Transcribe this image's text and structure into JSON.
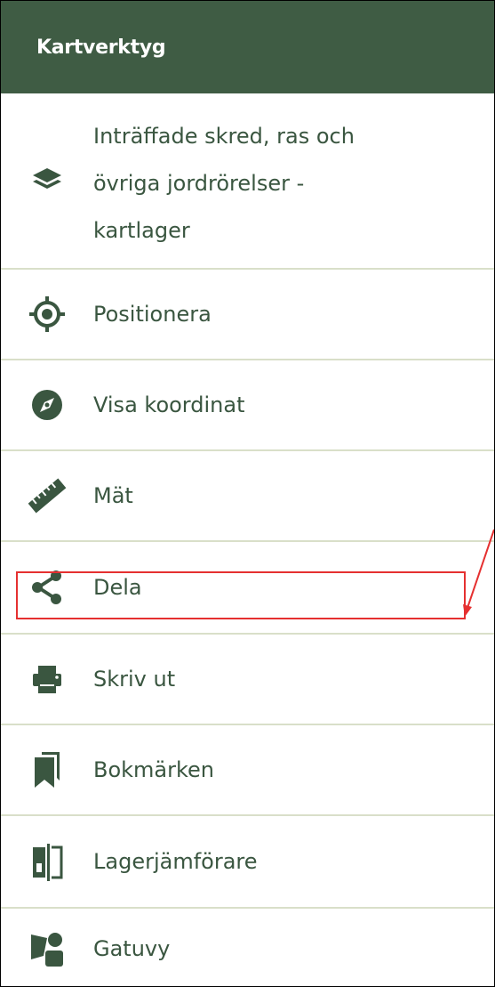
{
  "header": {
    "title": "Kartverktyg"
  },
  "items": [
    {
      "label_lines": [
        "Inträffade skred, ras och",
        "övriga jordrörelser -",
        "kartlager"
      ],
      "icon": "layers-icon"
    },
    {
      "label": "Positionera",
      "icon": "crosshair-icon"
    },
    {
      "label": "Visa koordinat",
      "icon": "compass-icon"
    },
    {
      "label": "Mät",
      "icon": "ruler-icon"
    },
    {
      "label": "Dela",
      "icon": "share-icon"
    },
    {
      "label": "Skriv ut",
      "icon": "print-icon"
    },
    {
      "label": "Bokmärken",
      "icon": "bookmarks-icon"
    },
    {
      "label": "Lagerjämförare",
      "icon": "compare-icon"
    },
    {
      "label": "Gatuvy",
      "icon": "street-view-icon"
    }
  ],
  "colors": {
    "header_bg": "#3f5c44",
    "text": "#3a5640",
    "divider": "#d9dfc9",
    "annotation": "#e53030"
  }
}
